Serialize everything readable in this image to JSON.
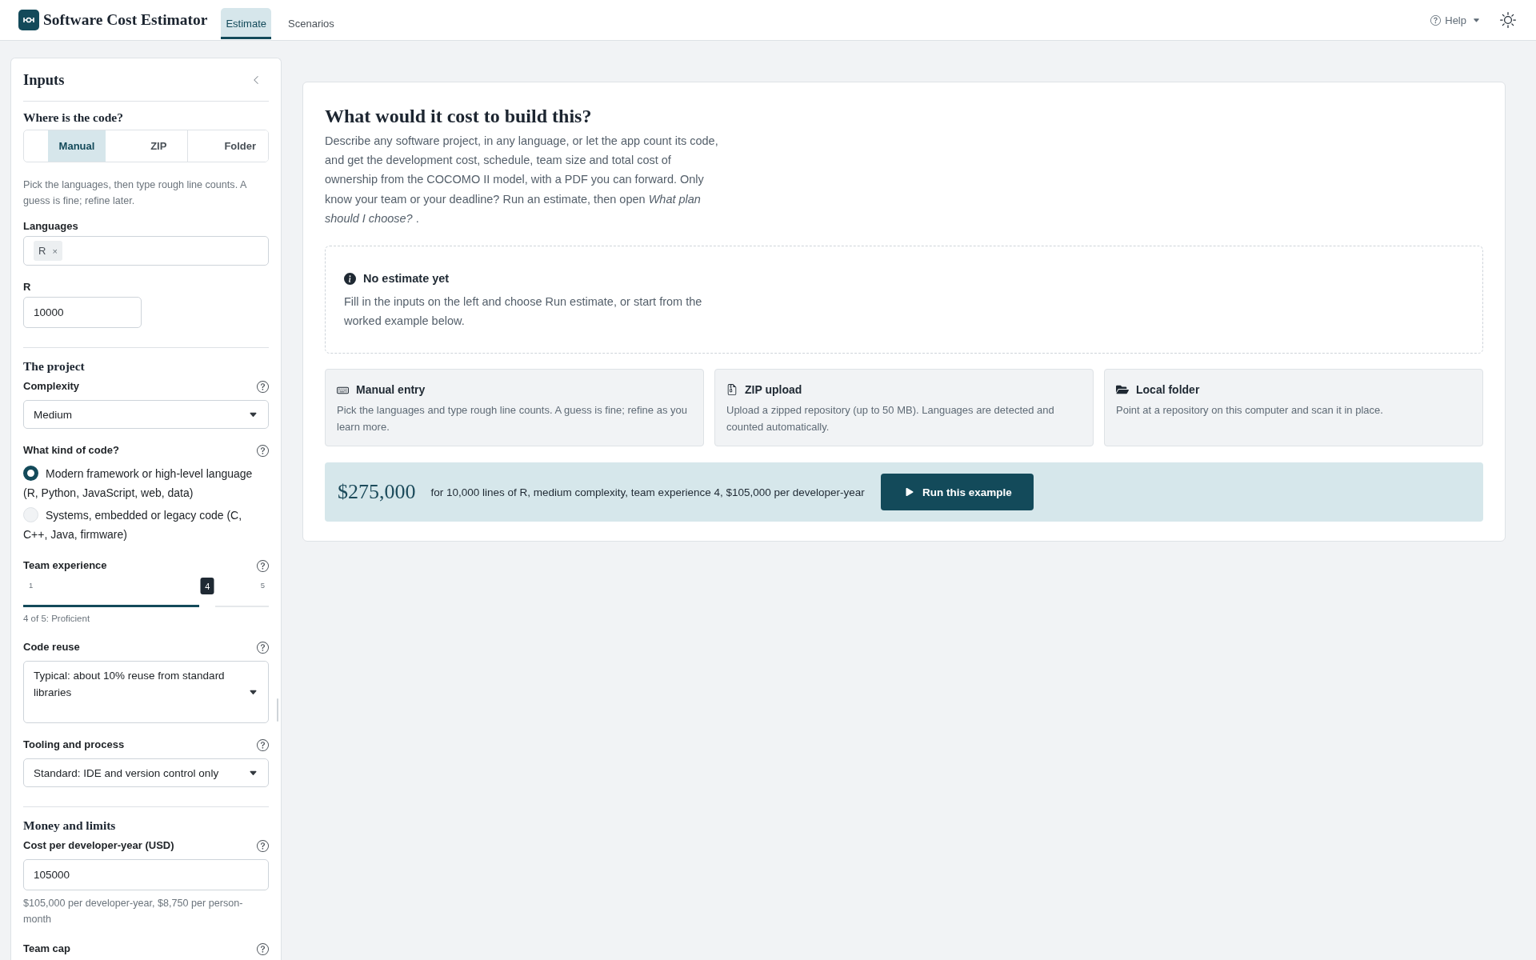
{
  "app_bar": {
    "title": "Software Cost Estimator",
    "tabs": [
      {
        "label": "Estimate",
        "selected": true
      },
      {
        "label": "Scenarios",
        "selected": false
      }
    ],
    "help_menu": "Help"
  },
  "sidebar": {
    "title": "Inputs",
    "sections": [
      {
        "heading": "Where is the code?",
        "fields": [
          {
            "kind": "segmented",
            "options": [
              {
                "label": "Manual",
                "selected": true
              },
              {
                "label": "ZIP",
                "selected": false
              },
              {
                "label": "Folder",
                "selected": false
              }
            ]
          },
          {
            "kind": "note",
            "text": "Pick the languages, then type rough line counts. A guess is fine; refine later."
          },
          {
            "kind": "chips",
            "label": "Languages",
            "help": false,
            "chips": [
              {
                "label": "R",
                "remove": "×"
              }
            ]
          },
          {
            "kind": "count",
            "label": "R",
            "help": false,
            "value": "10000"
          }
        ]
      },
      {
        "heading": "The project",
        "fields": [
          {
            "kind": "select",
            "label": "Complexity",
            "help": true,
            "value": "Medium"
          },
          {
            "kind": "radio",
            "label": "What kind of code?",
            "help": true,
            "options": [
              {
                "label": "Modern framework or high-level language (R, Python, JavaScript, web, data)",
                "selected": true
              },
              {
                "label": "Systems, embedded or legacy code (C, C++, Java, firmware)",
                "selected": false
              }
            ]
          },
          {
            "kind": "slider",
            "label": "Team experience",
            "help": true,
            "min": "1",
            "max": "5",
            "value": "4",
            "level": 0.75,
            "caption": "4 of 5: Proficient"
          },
          {
            "kind": "select",
            "label": "Code reuse",
            "help": true,
            "value": "Typical: about 10% reuse from standard libraries"
          },
          {
            "kind": "select",
            "label": "Tooling and process",
            "help": true,
            "value": "Standard: IDE and version control only"
          }
        ]
      },
      {
        "heading": "Money and limits",
        "fields": [
          {
            "kind": "number",
            "label": "Cost per developer-year (USD)",
            "help": true,
            "value": "105000",
            "note": "$105,000 per developer-year, $8,750 per person-month"
          },
          {
            "kind": "label",
            "label": "Team cap",
            "help": true
          }
        ]
      }
    ]
  },
  "intro": {
    "title": "What would it cost to build this?",
    "text": "Describe any software project, in any language, or let the app count its code, and get the development cost, schedule, team size and total cost of ownership from the COCOMO II model, with a PDF you can forward. Only know your team or your deadline? Run an estimate, then open *What plan should I choose?* ."
  },
  "notice": {
    "title": "No estimate yet",
    "text": "Fill in the inputs on the left and choose Run estimate, or start from the worked example below."
  },
  "entry_cards": [
    {
      "kind": "manual",
      "title": "Manual entry",
      "text": "Pick the languages and type rough line counts. A guess is fine; refine as you learn more."
    },
    {
      "kind": "zip",
      "title": "ZIP upload",
      "text": "Upload a zipped repository (up to 50 MB). Languages are detected and counted automatically."
    },
    {
      "kind": "folder",
      "title": "Local folder",
      "text": "Point at a repository on this computer and scan it in place."
    }
  ],
  "example": {
    "amount": "$275,000",
    "text": "for 10,000 lines of R, medium complexity, team experience 4, $105,000 per developer-year",
    "button": "Run this example"
  }
}
